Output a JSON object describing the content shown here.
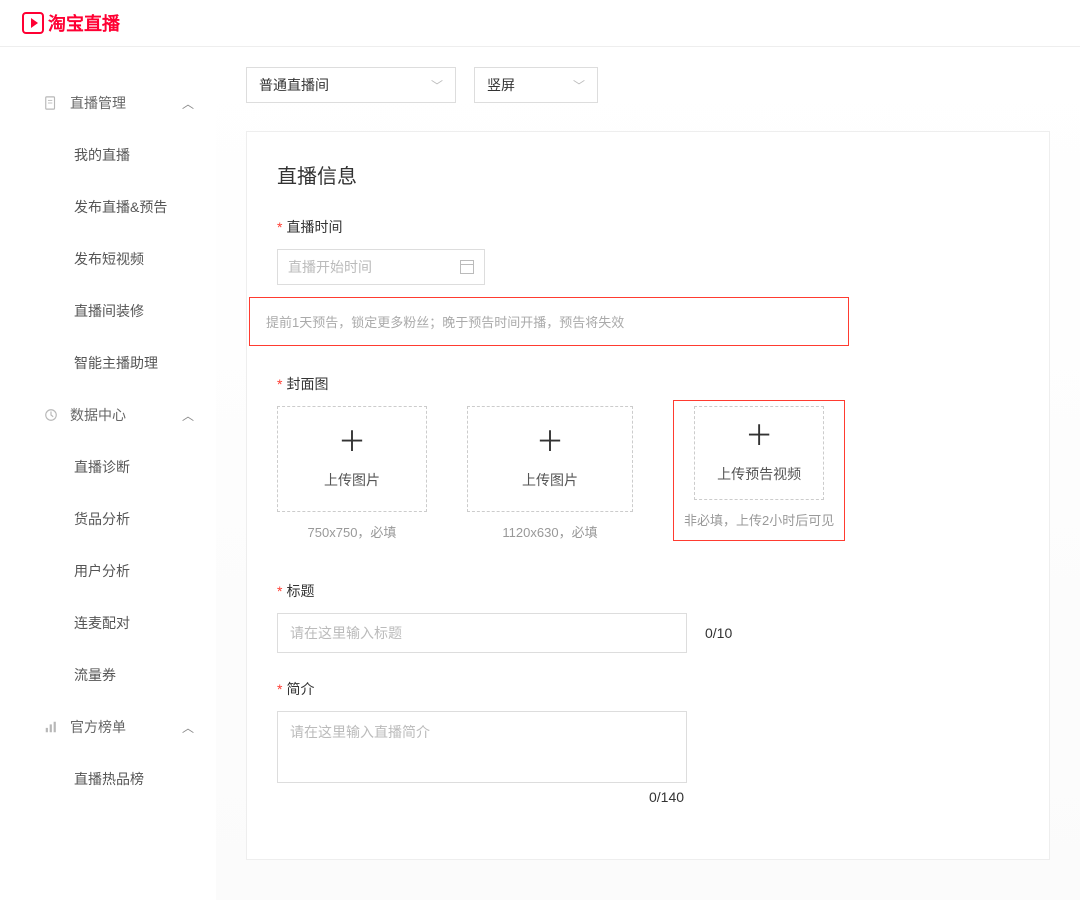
{
  "header": {
    "brand": "淘宝直播"
  },
  "sidebar": {
    "groups": [
      {
        "label": "直播管理",
        "icon": "doc",
        "items": [
          "我的直播",
          "发布直播&预告",
          "发布短视频",
          "直播间装修",
          "智能主播助理"
        ]
      },
      {
        "label": "数据中心",
        "icon": "clock",
        "items": [
          "直播诊断",
          "货品分析",
          "用户分析",
          "连麦配对",
          "流量券"
        ]
      },
      {
        "label": "官方榜单",
        "icon": "chart",
        "items": [
          "直播热品榜"
        ]
      }
    ]
  },
  "selectors": {
    "roomType": "普通直播间",
    "orientation": "竖屏"
  },
  "form": {
    "sectionTitle": "直播信息",
    "time": {
      "label": "直播时间",
      "placeholder": "直播开始时间",
      "hint": "提前1天预告，锁定更多粉丝；晚于预告时间开播，预告将失效"
    },
    "cover": {
      "label": "封面图",
      "uploads": [
        {
          "button": "上传图片",
          "caption": "750x750，必填"
        },
        {
          "button": "上传图片",
          "caption": "1120x630，必填"
        },
        {
          "button": "上传预告视频",
          "caption": "非必填，上传2小时后可见",
          "highlight": true
        }
      ]
    },
    "title": {
      "label": "标题",
      "placeholder": "请在这里输入标题",
      "counter": "0/10"
    },
    "intro": {
      "label": "简介",
      "placeholder": "请在这里输入直播简介",
      "counter": "0/140"
    }
  }
}
